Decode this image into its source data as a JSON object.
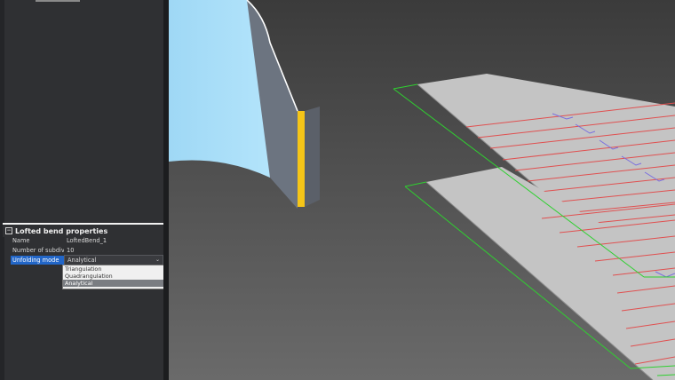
{
  "properties": {
    "title": "Lofted bend properties",
    "rows": [
      {
        "label": "Name",
        "value": "LoftedBend_1"
      },
      {
        "label": "Number of subdivis",
        "value": "10"
      },
      {
        "label": "Unfolding mode",
        "value": "Analytical"
      }
    ],
    "dropdown": {
      "options": [
        "Triangulation",
        "Quadrangulation",
        "Analytical"
      ],
      "selected": "Analytical"
    }
  },
  "colors": {
    "panel_bg": "#2f3033",
    "selection": "#2266c8",
    "bend_highlight": "#f5c518",
    "bend_lines": "#e05050",
    "dimension_lines": "#2fd030"
  }
}
